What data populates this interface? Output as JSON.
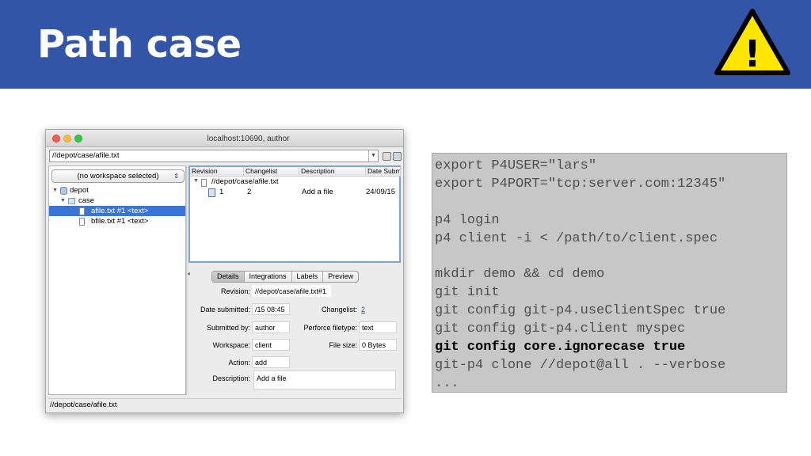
{
  "slide": {
    "title": "Path case",
    "warning_icon": "warning-triangle-icon",
    "warning_symbol": "!",
    "colors": {
      "header": "#3355a8",
      "warning_fill": "#ffe500",
      "selection": "#3875d7",
      "code_bg": "#c7c7c7"
    }
  },
  "window": {
    "title": "localhost:10690,  author",
    "path": "//depot/case/afile.txt",
    "workspace_select": "(no workspace selected)",
    "tree": [
      {
        "label": "depot",
        "icon": "database-icon"
      },
      {
        "label": "case",
        "icon": "folder-icon"
      },
      {
        "label": "afile.txt #1 <text>",
        "icon": "file-icon",
        "selected": true
      },
      {
        "label": "bfile.txt #1 <text>",
        "icon": "file-icon"
      }
    ],
    "history": {
      "columns": [
        "Revision",
        "Changelist",
        "Description",
        "Date Submitt"
      ],
      "file_path": "//depot/case/afile.txt",
      "rows": [
        {
          "revision": "1",
          "changelist": "2",
          "description": "Add a file",
          "date": "24/09/15"
        }
      ]
    },
    "details": {
      "tabs": [
        "Details",
        "Integrations",
        "Labels",
        "Preview"
      ],
      "active_tab": "Details",
      "revision_label": "Revision:",
      "revision": "//depot/case/afile.txt#1",
      "date_label": "Date submitted:",
      "date": "/15 08:45",
      "changelist_label": "Changelist:",
      "changelist": "2",
      "submitted_by_label": "Submitted by:",
      "submitted_by": "author",
      "filetype_label": "Perforce filetype:",
      "filetype": "text",
      "workspace_label": "Workspace:",
      "workspace": "client",
      "filesize_label": "File size:",
      "filesize": "0 Bytes",
      "action_label": "Action:",
      "action": "add",
      "description_label": "Description:",
      "description": "Add a file"
    },
    "status_path": "//depot/case/afile.txt"
  },
  "code": {
    "lines": [
      "export P4USER=\"lars\"",
      "export P4PORT=\"tcp:server.com:12345\"",
      "",
      "p4 login",
      "p4 client -i < /path/to/client.spec",
      "",
      "mkdir demo && cd demo",
      "git init",
      "git config git-p4.useClientSpec true",
      "git config git-p4.client myspec",
      "git config core.ignorecase true",
      "git-p4 clone //depot@all . --verbose",
      "..."
    ],
    "highlighted_line": "git config core.ignorecase true"
  }
}
